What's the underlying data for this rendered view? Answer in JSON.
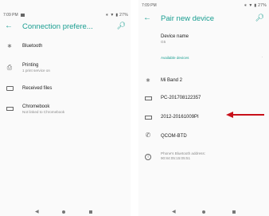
{
  "left": {
    "status": {
      "time": "7:09 PM",
      "icons": "∗ ▼ ▮ 27%"
    },
    "appbar": {
      "title": "Connection prefere..."
    },
    "items": [
      {
        "icon": "bluetooth-icon",
        "label": "Bluetooth",
        "sub": ""
      },
      {
        "icon": "printer-icon",
        "label": "Printing",
        "sub": "1 print service on"
      },
      {
        "icon": "folder-icon",
        "label": "Received files",
        "sub": ""
      },
      {
        "icon": "chromebook-icon",
        "label": "Chromebook",
        "sub": "Not linked to Chromebook"
      }
    ]
  },
  "right": {
    "status": {
      "time": "7:09 PM",
      "icons": "∗ ▼ ▮ 27%"
    },
    "appbar": {
      "title": "Pair new device"
    },
    "device_name": {
      "label": "Device name",
      "value": "G5"
    },
    "available_label": "Available devices",
    "devices": [
      {
        "icon": "bluetooth-icon",
        "name": "Mi Band 2"
      },
      {
        "icon": "laptop-icon",
        "name": "PC-201708122357"
      },
      {
        "icon": "laptop-icon",
        "name": "2012-20161009PI"
      },
      {
        "icon": "phone-icon",
        "name": "QCOM-BTD"
      }
    ],
    "address_note": {
      "line1": "Phone's Bluetooth address:",
      "line2": "90:84:05:15:05:51"
    }
  },
  "colors": {
    "accent": "#1a9e91",
    "arrow": "#c8101a"
  }
}
